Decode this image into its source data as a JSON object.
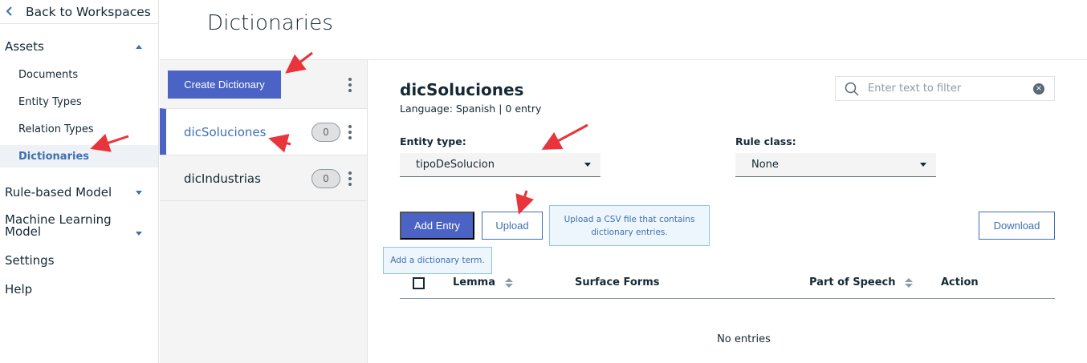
{
  "sidebar": {
    "back_label": "Back to Workspaces",
    "assets_label": "Assets",
    "items": [
      {
        "label": "Documents"
      },
      {
        "label": "Entity Types"
      },
      {
        "label": "Relation Types"
      },
      {
        "label": "Dictionaries"
      }
    ],
    "sections": [
      {
        "label": "Rule-based Model"
      },
      {
        "label": "Machine Learning Model"
      },
      {
        "label": "Settings"
      },
      {
        "label": "Help"
      }
    ]
  },
  "page": {
    "title": "Dictionaries"
  },
  "dictionaries": {
    "create_label": "Create Dictionary",
    "list": [
      {
        "name": "dicSoluciones",
        "count": "0"
      },
      {
        "name": "dicIndustrias",
        "count": "0"
      }
    ]
  },
  "detail": {
    "title": "dicSoluciones",
    "meta": "Language: Spanish | 0 entry",
    "filter_placeholder": "Enter text to filter",
    "entity_type_label": "Entity type:",
    "entity_type_value": "tipoDeSolucion",
    "rule_class_label": "Rule class:",
    "rule_class_value": "None",
    "add_entry_label": "Add Entry",
    "add_entry_tooltip": "Add a dictionary term.",
    "upload_label": "Upload",
    "upload_tooltip": "Upload a CSV file that contains dictionary entries.",
    "download_label": "Download",
    "columns": [
      "Lemma",
      "Surface Forms",
      "Part of Speech",
      "Action"
    ],
    "empty_message": "No entries"
  },
  "colors": {
    "accent": "#4a63c4",
    "link": "#3d70b2",
    "annotation_arrow": "#e8343a"
  }
}
